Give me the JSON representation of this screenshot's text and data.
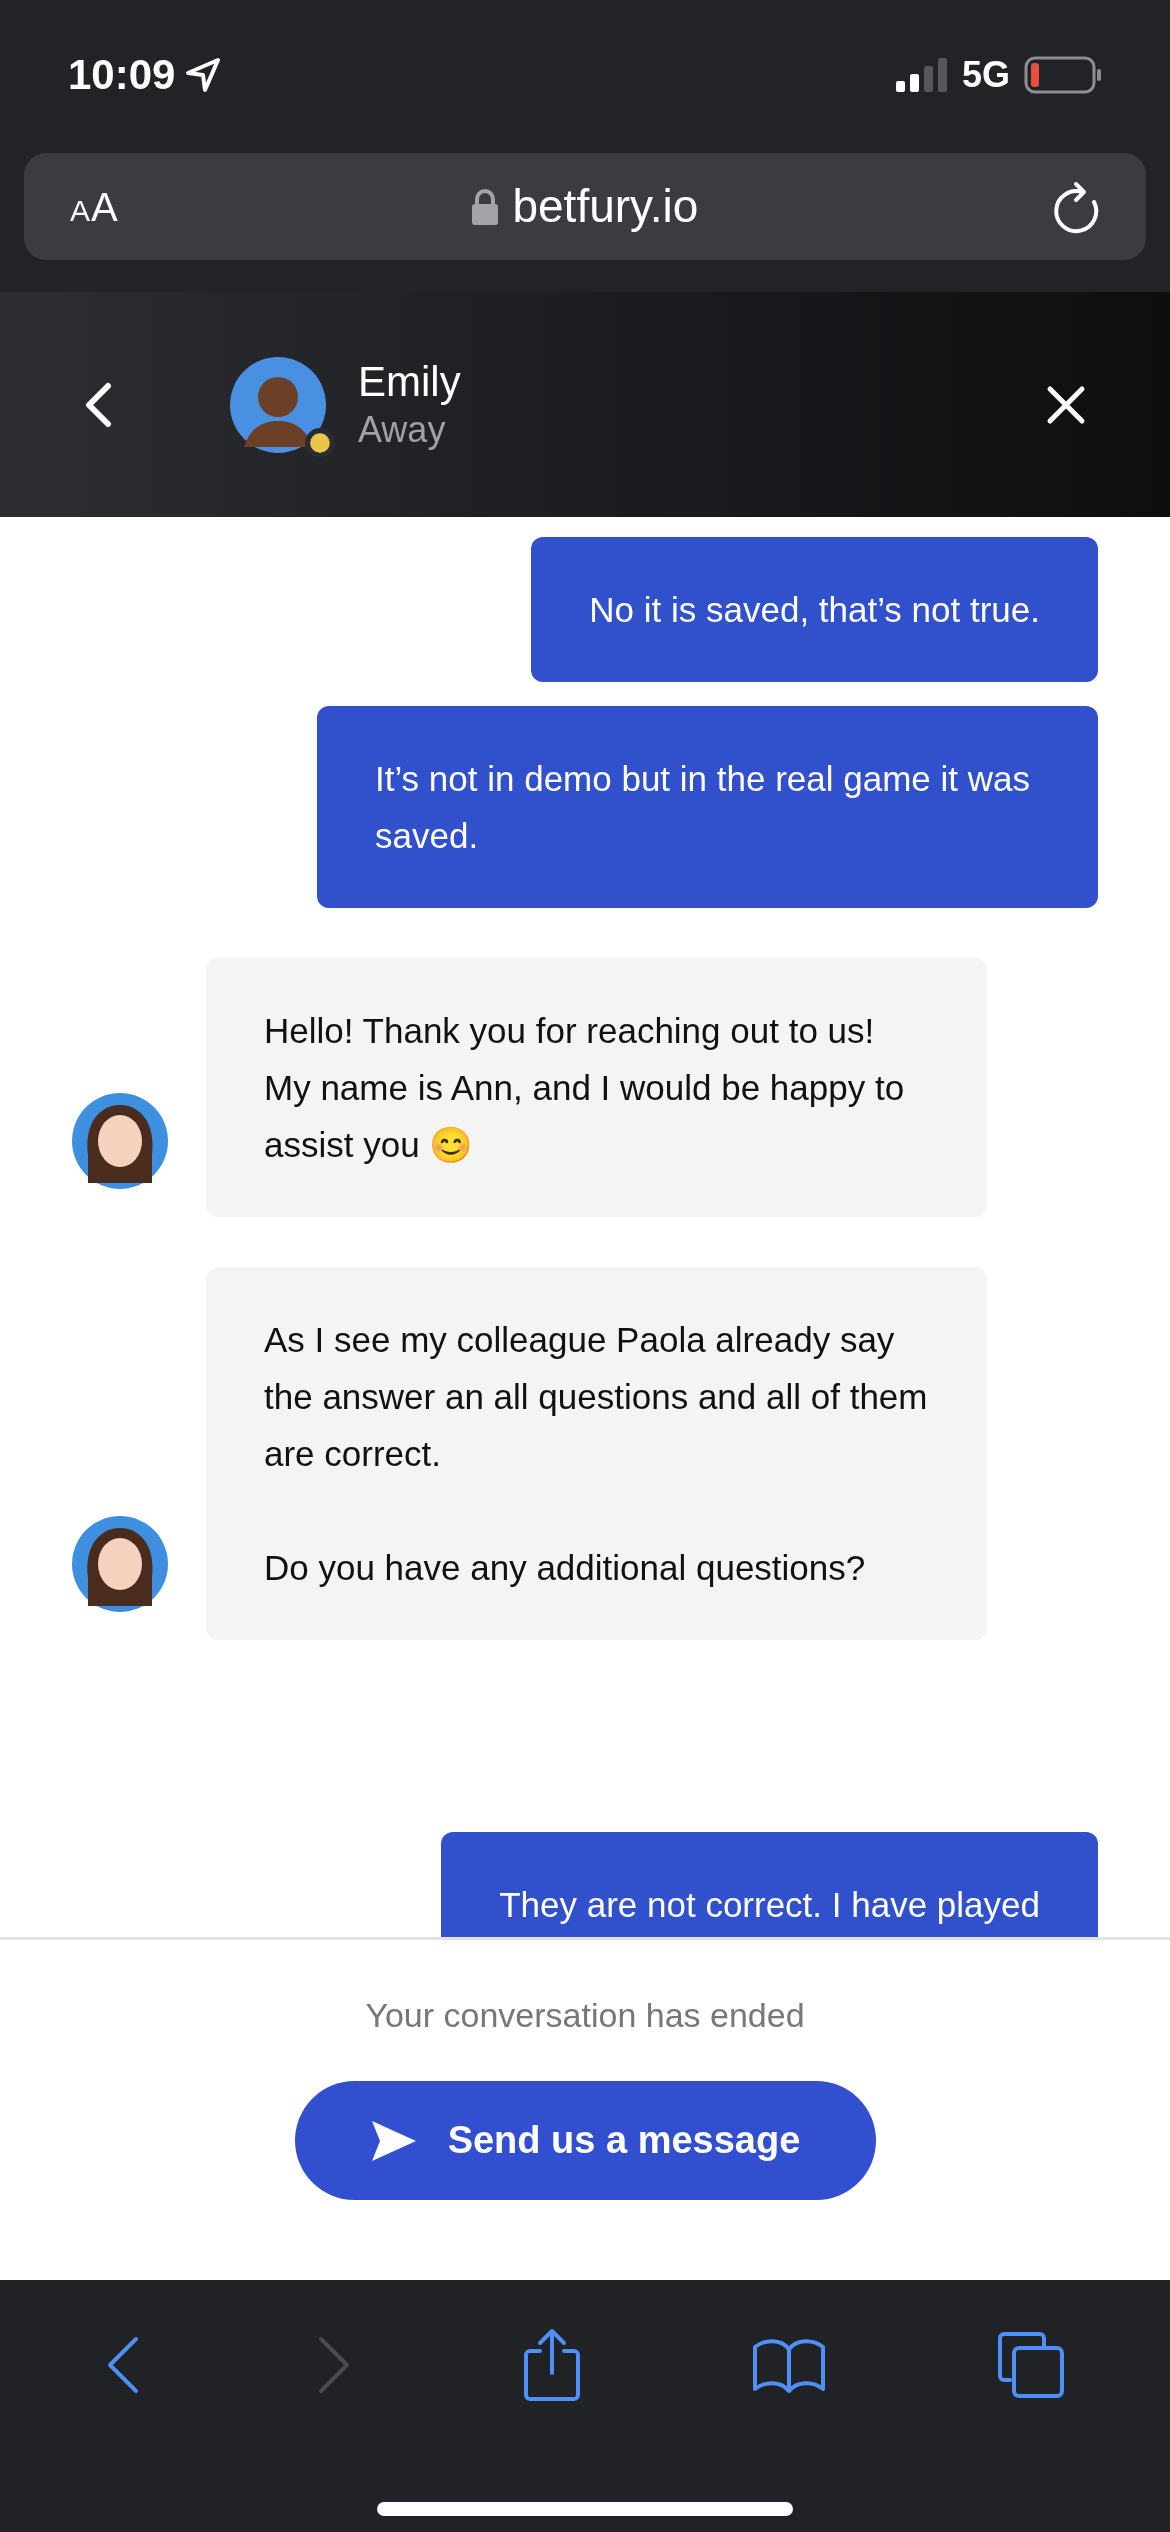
{
  "status_bar": {
    "time": "10:09",
    "network": "5G"
  },
  "browser": {
    "text_size_button": "AA",
    "url": "betfury.io"
  },
  "chat_header": {
    "agent_name": "Emily",
    "agent_status": "Away",
    "color": "#e9c54b"
  },
  "messages": [
    {
      "kind": "user",
      "paragraphs": [
        "No it is saved, that’s not true."
      ]
    },
    {
      "kind": "user",
      "paragraphs": [
        "It’s not in demo but in the real game it was saved."
      ]
    },
    {
      "kind": "agent",
      "paragraphs": [
        "Hello! Thank you for reaching out to us!\nMy name is Ann, and I would be happy to assist you 😊"
      ]
    },
    {
      "kind": "agent",
      "paragraphs": [
        "As I see my colleague Paola already say the answer an all questions and all of them are correct.",
        "Do you have any additional questions?"
      ]
    },
    {
      "kind": "user",
      "paragraphs": [
        "They are not correct. I have played"
      ],
      "cut": true
    }
  ],
  "footer": {
    "notice": "Your conversation has ended",
    "button": "Send us a message"
  },
  "toolbar": [
    {
      "kind": "back",
      "disabled": false
    },
    {
      "kind": "forward",
      "disabled": true
    },
    {
      "kind": "share",
      "disabled": false
    },
    {
      "kind": "bookmarks",
      "disabled": false
    },
    {
      "kind": "tabs",
      "disabled": false
    }
  ]
}
